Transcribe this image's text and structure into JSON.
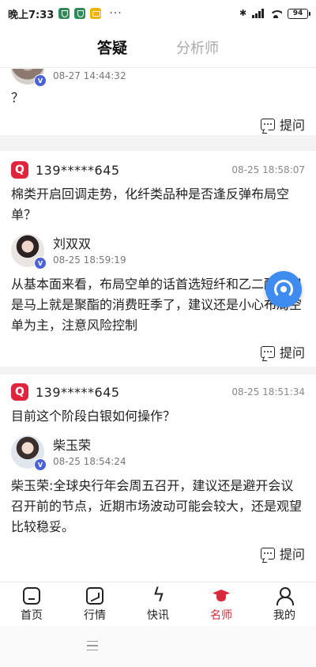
{
  "status_bar": {
    "time": "晚上7:33",
    "dots": "···",
    "battery": "94"
  },
  "header": {
    "tabs": [
      {
        "label": "答疑",
        "active": true
      },
      {
        "label": "分析师",
        "active": false
      }
    ]
  },
  "cards": [
    {
      "question": null,
      "answer": {
        "name": "",
        "time": "08-27 14:44:32",
        "text": "？"
      },
      "reply_label": "提问"
    },
    {
      "question": {
        "badge": "Q",
        "user": "139*****645",
        "time": "08-25 18:58:07",
        "text": "棉类开启回调走势，化纤类品种是否逢反弹布局空单？"
      },
      "answer": {
        "name": "刘双双",
        "time": "08-25 18:59:19",
        "text": "从基本面来看，布局空单的话首选短纤和乙二醇。但是马上就是聚酯的消费旺季了，建议还是小心布局空单为主，注意风险控制"
      },
      "reply_label": "提问"
    },
    {
      "question": {
        "badge": "Q",
        "user": "139*****645",
        "time": "08-25 18:51:34",
        "text": "目前这个阶段白银如何操作？"
      },
      "answer": {
        "name": "柴玉荣",
        "time": "08-25 18:54:24",
        "text": "柴玉荣:全球央行年会周五召开，建议还是避开会议召开前的节点，近期市场波动可能会较大，还是观望比较稳妥。"
      },
      "reply_label": "提问"
    }
  ],
  "bottom_nav": {
    "items": [
      {
        "label": "首页",
        "icon": "home-icon",
        "active": false
      },
      {
        "label": "行情",
        "icon": "market-icon",
        "active": false
      },
      {
        "label": "快讯",
        "icon": "flash-icon",
        "active": false
      },
      {
        "label": "名师",
        "icon": "teacher-icon",
        "active": true
      },
      {
        "label": "我的",
        "icon": "profile-icon",
        "active": false
      }
    ]
  },
  "colors": {
    "accent": "#d82a3a",
    "question_badge": "#e0243c",
    "verified_badge": "#4a63d8",
    "float_button": "#3f8cf0"
  }
}
